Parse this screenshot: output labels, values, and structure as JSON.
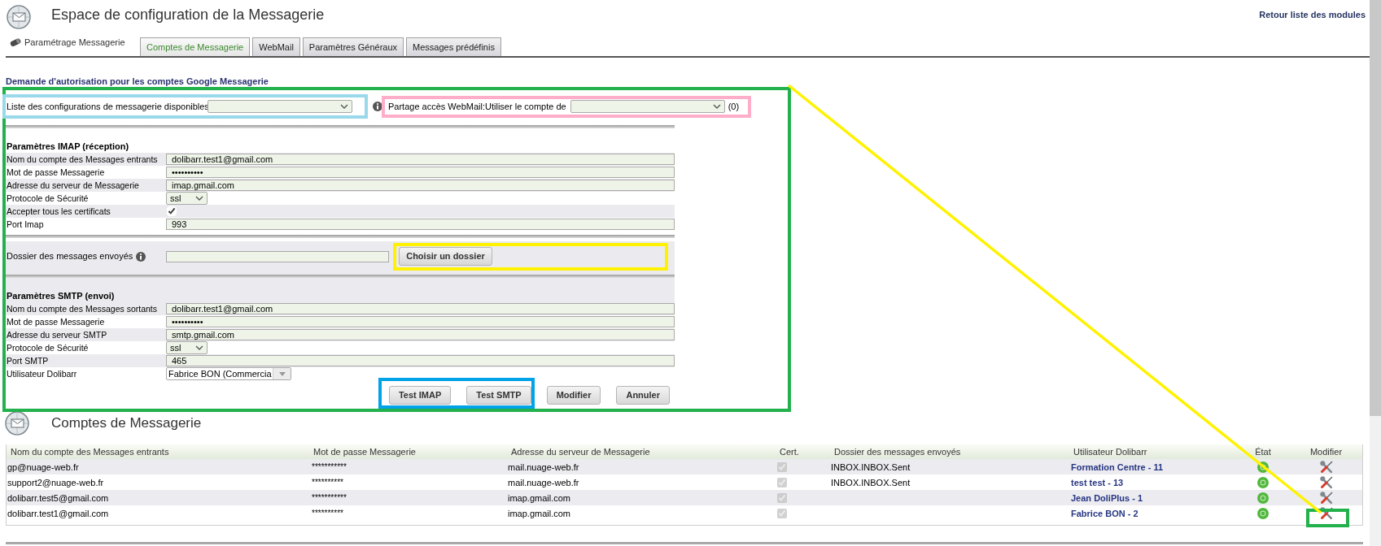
{
  "header": {
    "title": "Espace de configuration de la Messagerie",
    "back_link": "Retour liste des modules"
  },
  "tabs": {
    "heading": "Paramétrage Messagerie",
    "items": [
      {
        "label": "Comptes de Messagerie",
        "selected": true
      },
      {
        "label": "WebMail",
        "selected": false
      },
      {
        "label": "Paramètres Généraux",
        "selected": false
      },
      {
        "label": "Messages prédéfinis",
        "selected": false
      }
    ]
  },
  "google_auth": {
    "title": "Demande d'autorisation pour les comptes Google Messagerie"
  },
  "form": {
    "config_select": {
      "label": "Liste des configurations de messagerie disponibles"
    },
    "webmail_share": {
      "label": "Partage accès WebMail:Utiliser le compte de",
      "count": "(0)"
    },
    "imap": {
      "title": "Paramètres IMAP (réception)",
      "fields": [
        {
          "kind": "text",
          "label": "Nom du compte des Messages entrants",
          "value": "dolibarr.test1@gmail.com"
        },
        {
          "kind": "text",
          "label": "Mot de passe Messagerie",
          "value": "••••••••••"
        },
        {
          "kind": "text",
          "label": "Adresse du serveur de Messagerie",
          "value": "imap.gmail.com"
        },
        {
          "kind": "select",
          "label": "Protocole de Sécurité",
          "value": "ssl"
        },
        {
          "kind": "checkbox",
          "label": "Accepter tous les certificats",
          "checked": true
        },
        {
          "kind": "text",
          "label": "Port Imap",
          "value": "993"
        }
      ]
    },
    "sent_folder": {
      "label": "Dossier des messages envoyés",
      "button": "Choisir un dossier"
    },
    "smtp": {
      "title": "Paramètres SMTP (envoi)",
      "fields": [
        {
          "kind": "text",
          "label": "Nom du compte des Messages sortants",
          "value": "dolibarr.test1@gmail.com"
        },
        {
          "kind": "text",
          "label": "Mot de passe Messagerie",
          "value": "••••••••••"
        },
        {
          "kind": "text",
          "label": "Adresse du serveur SMTP",
          "value": "smtp.gmail.com"
        },
        {
          "kind": "select",
          "label": "Protocole de Sécurité",
          "value": "ssl"
        },
        {
          "kind": "text",
          "label": "Port SMTP",
          "value": "465"
        },
        {
          "kind": "combo",
          "label": "Utilisateur Dolibarr",
          "value": "Fabrice BON (Commercia"
        }
      ]
    },
    "buttons": [
      "Test IMAP",
      "Test SMTP",
      "Modifier",
      "Annuler"
    ]
  },
  "accounts": {
    "title": "Comptes de Messagerie",
    "columns": [
      "Nom du compte des Messages entrants",
      "Mot de passe Messagerie",
      "Adresse du serveur de Messagerie",
      "Cert.",
      "Dossier des messages envoyés",
      "Utilisateur Dolibarr",
      "État",
      "Modifier"
    ],
    "rows": [
      {
        "account": "gp@nuage-web.fr",
        "password": "***********",
        "server": "mail.nuage-web.fr",
        "cert": true,
        "sent_folder": "INBOX.INBOX.Sent",
        "user": "Formation Centre - 11",
        "active": true
      },
      {
        "account": "support2@nuage-web.fr",
        "password": "**********",
        "server": "mail.nuage-web.fr",
        "cert": true,
        "sent_folder": "INBOX.INBOX.Sent",
        "user": "test test - 13",
        "active": true
      },
      {
        "account": "dolibarr.test5@gmail.com",
        "password": "***********",
        "server": "imap.gmail.com",
        "cert": true,
        "user": "Jean DoliPlus - 1",
        "active": true
      },
      {
        "account": "dolibarr.test1@gmail.com",
        "password": "**********",
        "server": "imap.gmail.com",
        "cert": true,
        "user": "Fabrice BON - 2",
        "active": true
      }
    ]
  },
  "annotations": [
    {
      "kind": "frame",
      "color": "#22b14c"
    },
    {
      "kind": "frame",
      "color": "#99d9ea"
    },
    {
      "kind": "frame",
      "color": "#ffaec9"
    },
    {
      "kind": "frame",
      "color": "#fff200"
    },
    {
      "kind": "frame",
      "color": "#00a2e8"
    },
    {
      "kind": "frame",
      "color": "#22b14c"
    },
    {
      "kind": "line",
      "color": "#fff200"
    }
  ]
}
